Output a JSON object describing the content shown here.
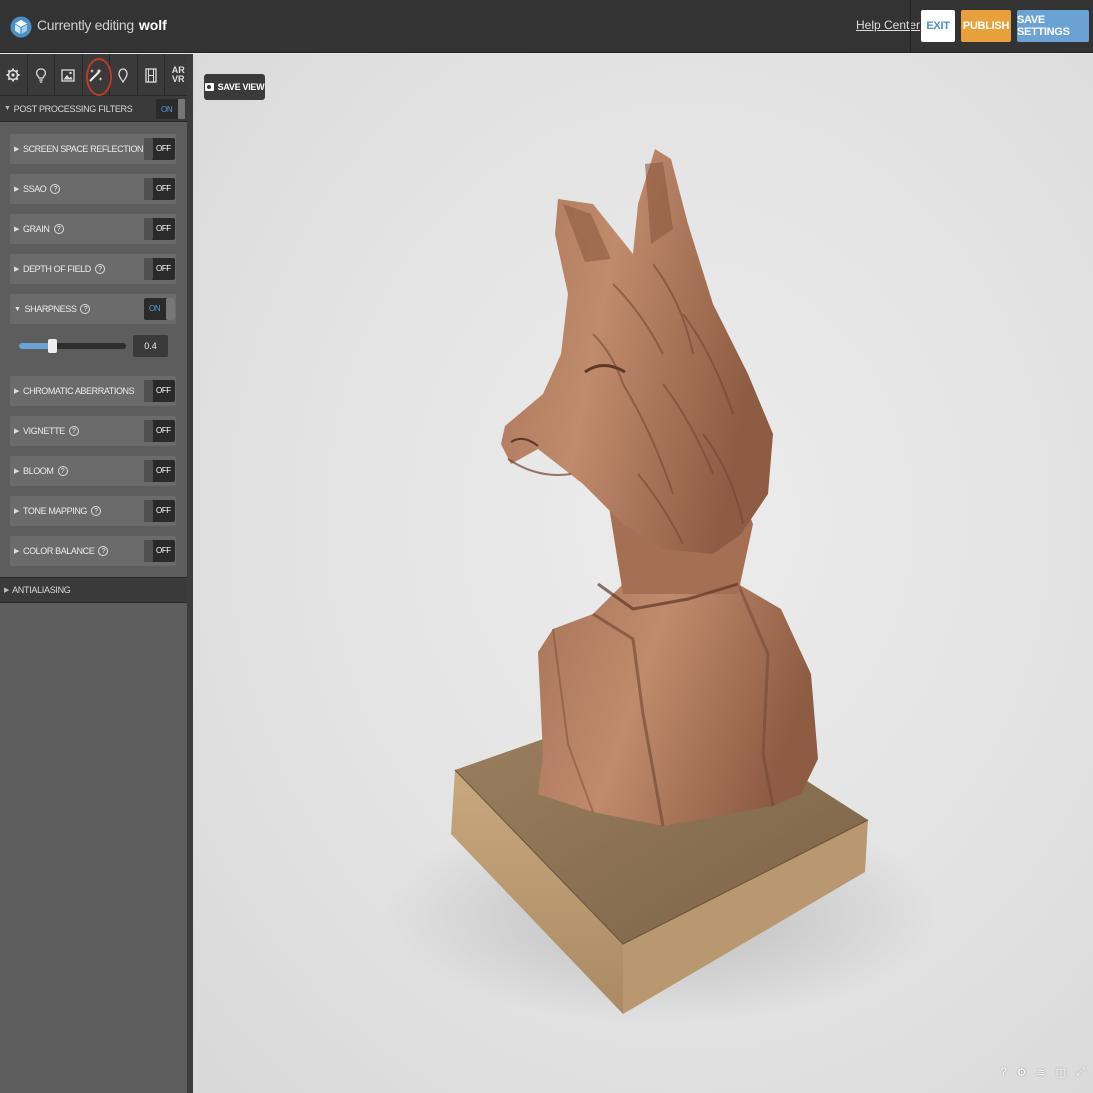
{
  "header": {
    "prefix": "Currently editing",
    "model_name": "wolf",
    "help_link": "Help Center",
    "exit_label": "EXIT",
    "publish_label": "PUBLISH",
    "save_settings_label": "SAVE SETTINGS"
  },
  "tool_tabs": [
    {
      "icon": "gear-icon",
      "glyph": "⚙"
    },
    {
      "icon": "bulb-icon",
      "glyph": "💡"
    },
    {
      "icon": "image-icon",
      "glyph": "🖼"
    },
    {
      "icon": "magic-wand-icon",
      "glyph": "✨"
    },
    {
      "icon": "pin-icon",
      "glyph": "⬯"
    },
    {
      "icon": "film-icon",
      "glyph": "🎞"
    },
    {
      "icon": "ar-vr-icon",
      "glyph": "AR VR"
    }
  ],
  "sections": {
    "post_processing": {
      "label": "POST PROCESSING FILTERS",
      "toggle": "ON"
    },
    "antialiasing": {
      "label": "ANTIALIASING"
    }
  },
  "filters": [
    {
      "label": "SCREEN SPACE REFLECTION",
      "state": "OFF",
      "help": "?"
    },
    {
      "label": "SSAO",
      "state": "OFF",
      "help": "?"
    },
    {
      "label": "GRAIN",
      "state": "OFF",
      "help": "?"
    },
    {
      "label": "DEPTH OF FIELD",
      "state": "OFF",
      "help": "?"
    },
    {
      "label": "SHARPNESS",
      "state": "ON",
      "help": "?"
    },
    {
      "label": "CHROMATIC ABERRATIONS",
      "state": "OFF",
      "help": ""
    },
    {
      "label": "VIGNETTE",
      "state": "OFF",
      "help": "?"
    },
    {
      "label": "BLOOM",
      "state": "OFF",
      "help": "?"
    },
    {
      "label": "TONE MAPPING",
      "state": "OFF",
      "help": "?"
    },
    {
      "label": "COLOR BALANCE",
      "state": "OFF",
      "help": "?"
    }
  ],
  "sharpness": {
    "value": "0.4",
    "fraction": 0.3
  },
  "viewport": {
    "save_view_label": "SAVE VIEW",
    "icons": [
      "help-icon",
      "settings-icon",
      "layers-icon",
      "vr-icon",
      "fullscreen-icon"
    ]
  },
  "colors": {
    "accent": "#6aa3d3",
    "publish": "#e8a03a",
    "active_ring": "#c0392b"
  }
}
